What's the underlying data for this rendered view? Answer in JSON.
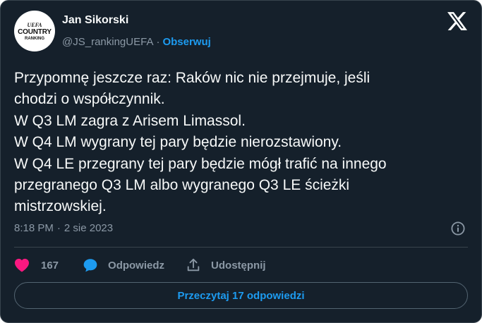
{
  "author": {
    "display_name": "Jan Sikorski",
    "handle": "@JS_rankingUEFA",
    "separator": "·",
    "follow_label": "Obserwuj",
    "avatar": {
      "line1": "UEFA",
      "line2": "COUNTRY",
      "line3": "RANKING"
    }
  },
  "tweet": {
    "lines": [
      "Przypomnę jeszcze raz: Raków nic nie przejmuje, jeśli",
      "chodzi o współczynnik.",
      "W Q3 LM zagra z Arisem Limassol.",
      "W Q4 LM wygrany tej pary będzie nierozstawiony.",
      "W Q4 LE przegrany tej pary będzie mógł trafić na innego",
      "przegranego Q3 LM albo wygranego Q3 LE ścieżki",
      "mistrzowskiej."
    ]
  },
  "meta": {
    "time": "8:18 PM",
    "separator": "·",
    "date": "2 sie 2023"
  },
  "actions": {
    "likes_count": "167",
    "reply_label": "Odpowiedz",
    "share_label": "Udostępnij"
  },
  "read_replies_label": "Przeczytaj 17 odpowiedzi",
  "colors": {
    "background": "#15202b",
    "border": "#38444d",
    "text_primary": "#f7f9f9",
    "text_secondary": "#8b98a5",
    "accent": "#1d9bf0",
    "like": "#f91880"
  },
  "icons": {
    "logo": "x-logo-icon",
    "info": "info-icon",
    "like": "heart-icon",
    "reply": "chat-bubble-icon",
    "share": "share-icon"
  }
}
